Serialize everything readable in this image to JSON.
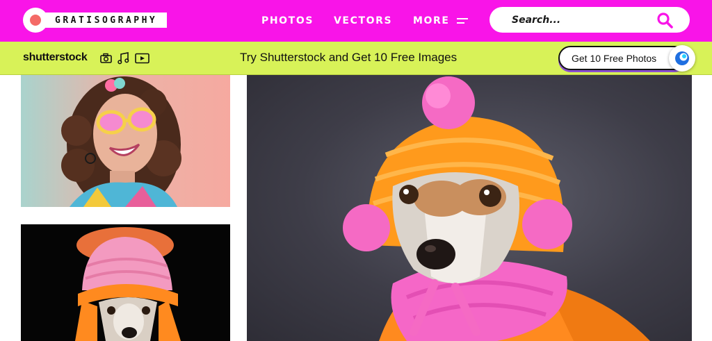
{
  "brand": {
    "name": "GRATISOGRAPHY"
  },
  "nav": {
    "photos": "PHOTOS",
    "vectors": "VECTORS",
    "more": "MORE"
  },
  "search": {
    "placeholder": "Search..."
  },
  "promo": {
    "brand": "shutterstock",
    "text": "Try Shutterstock and Get 10 Free Images",
    "button": "Get 10 Free Photos",
    "icons": [
      "camera-icon",
      "music-note-icon",
      "video-play-icon"
    ]
  },
  "colors": {
    "header_bg": "#f914e8",
    "promo_bg": "#d8f258",
    "accent": "#f914e8"
  },
  "images": [
    {
      "id": "woman-sunglasses-photo",
      "alt": "Smiling woman wearing pink sunglasses"
    },
    {
      "id": "dog-pink-beanie-photo",
      "alt": "Dog wearing pink and orange knit hat"
    },
    {
      "id": "dog-orange-hat-photo",
      "alt": "Dog wearing orange knit hat with pink pompoms"
    }
  ]
}
